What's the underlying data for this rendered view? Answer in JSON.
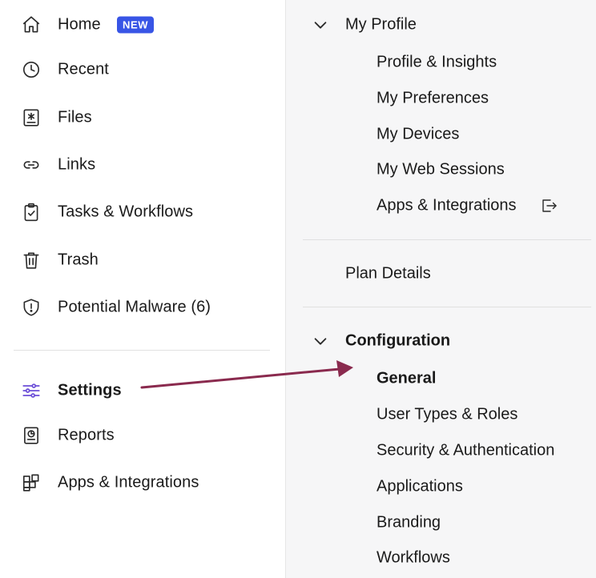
{
  "sidebar": {
    "items": [
      {
        "label": "Home",
        "icon": "home-icon",
        "badge": "NEW"
      },
      {
        "label": "Recent",
        "icon": "clock-icon"
      },
      {
        "label": "Files",
        "icon": "files-icon"
      },
      {
        "label": "Links",
        "icon": "link-icon"
      },
      {
        "label": "Tasks & Workflows",
        "icon": "clipboard-check-icon"
      },
      {
        "label": "Trash",
        "icon": "trash-icon"
      },
      {
        "label": "Potential Malware (6)",
        "icon": "shield-alert-icon"
      }
    ],
    "bottom_items": [
      {
        "label": "Settings",
        "icon": "sliders-icon",
        "active": true
      },
      {
        "label": "Reports",
        "icon": "report-icon"
      },
      {
        "label": "Apps & Integrations",
        "icon": "apps-grid-icon"
      }
    ]
  },
  "settings_menu": {
    "my_profile": {
      "label": "My Profile",
      "items": [
        "Profile & Insights",
        "My Preferences",
        "My Devices",
        "My Web Sessions",
        "Apps & Integrations"
      ]
    },
    "plan_details": {
      "label": "Plan Details"
    },
    "configuration": {
      "label": "Configuration",
      "items": [
        "General",
        "User Types & Roles",
        "Security & Authentication",
        "Applications",
        "Branding",
        "Workflows"
      ],
      "selected": "General"
    }
  },
  "colors": {
    "badge": "#3855e6",
    "settings_icon": "#6c4fd8",
    "annotation_arrow": "#8a2a4e",
    "right_panel_bg": "#f6f6f7"
  }
}
